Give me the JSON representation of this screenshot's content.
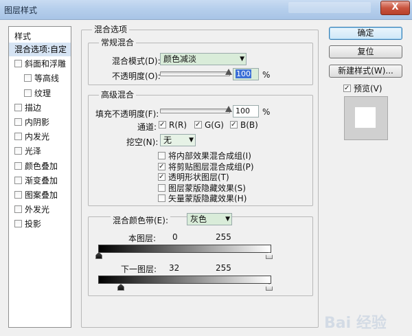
{
  "window": {
    "title": "图层样式",
    "close_label": "X"
  },
  "styles_list": {
    "header": "样式",
    "items": [
      {
        "label": "混合选项:自定",
        "checkbox": false,
        "checked": false,
        "selected": true,
        "indent": 0
      },
      {
        "label": "斜面和浮雕",
        "checkbox": true,
        "checked": false,
        "selected": false,
        "indent": 0
      },
      {
        "label": "等高线",
        "checkbox": true,
        "checked": false,
        "selected": false,
        "indent": 1
      },
      {
        "label": "纹理",
        "checkbox": true,
        "checked": false,
        "selected": false,
        "indent": 1
      },
      {
        "label": "描边",
        "checkbox": true,
        "checked": false,
        "selected": false,
        "indent": 0
      },
      {
        "label": "内阴影",
        "checkbox": true,
        "checked": false,
        "selected": false,
        "indent": 0
      },
      {
        "label": "内发光",
        "checkbox": true,
        "checked": false,
        "selected": false,
        "indent": 0
      },
      {
        "label": "光泽",
        "checkbox": true,
        "checked": false,
        "selected": false,
        "indent": 0
      },
      {
        "label": "颜色叠加",
        "checkbox": true,
        "checked": false,
        "selected": false,
        "indent": 0
      },
      {
        "label": "渐变叠加",
        "checkbox": true,
        "checked": false,
        "selected": false,
        "indent": 0
      },
      {
        "label": "图案叠加",
        "checkbox": true,
        "checked": false,
        "selected": false,
        "indent": 0
      },
      {
        "label": "外发光",
        "checkbox": true,
        "checked": false,
        "selected": false,
        "indent": 0
      },
      {
        "label": "投影",
        "checkbox": true,
        "checked": false,
        "selected": false,
        "indent": 0
      }
    ]
  },
  "blend_options": {
    "title": "混合选项",
    "general": {
      "title": "常规混合",
      "mode_label": "混合模式(D):",
      "mode_value": "颜色减淡",
      "opacity_label": "不透明度(O):",
      "opacity_value": "100",
      "opacity_unit": "%",
      "opacity_fraction": 1.0
    },
    "advanced": {
      "title": "高级混合",
      "fill_label": "填充不透明度(F):",
      "fill_value": "100",
      "fill_unit": "%",
      "fill_fraction": 1.0,
      "channels_label": "通道:",
      "channels": [
        {
          "label": "R(R)",
          "checked": true
        },
        {
          "label": "G(G)",
          "checked": true
        },
        {
          "label": "B(B)",
          "checked": true
        }
      ],
      "knockout_label": "挖空(N):",
      "knockout_value": "无",
      "options": [
        {
          "label": "将内部效果混合成组(I)",
          "checked": false
        },
        {
          "label": "将剪贴图层混合成组(P)",
          "checked": true
        },
        {
          "label": "透明形状图层(T)",
          "checked": true
        },
        {
          "label": "图层蒙版隐藏效果(S)",
          "checked": false
        },
        {
          "label": "矢量蒙版隐藏效果(H)",
          "checked": false
        }
      ]
    },
    "blend_if": {
      "label": "混合颜色带(E):",
      "value": "灰色",
      "this_layer_label": "本图层:",
      "this_layer_min": "0",
      "this_layer_max": "255",
      "underlying_label": "下一图层:",
      "underlying_min": "32",
      "underlying_max": "255"
    }
  },
  "buttons": {
    "ok": "确定",
    "reset": "复位",
    "new_style": "新建样式(W)...",
    "preview_label": "预览(V)",
    "preview_checked": true
  },
  "watermark": "Bai 经验",
  "colors": {
    "selected_bg": "#d6e4f4",
    "select_bg": "#d9ecd9",
    "title_bar": "#b6cfec",
    "close": "#c9553f"
  }
}
